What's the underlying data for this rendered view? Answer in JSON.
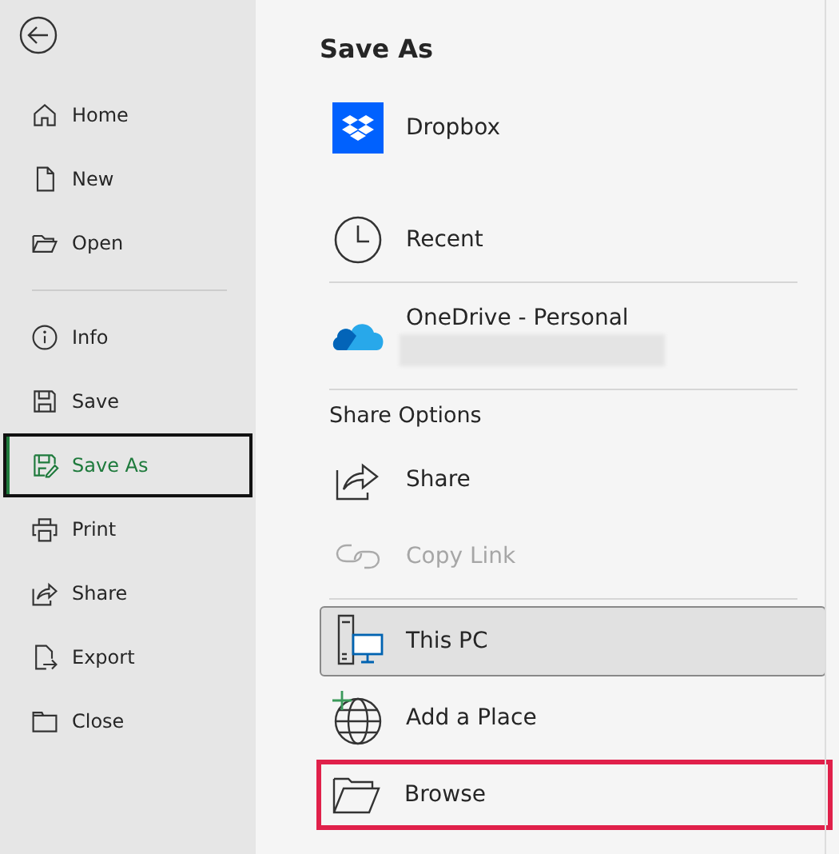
{
  "sidebar": {
    "items": [
      {
        "kind": "item",
        "label": "Home",
        "selected": false
      },
      {
        "kind": "item",
        "label": "New",
        "selected": false
      },
      {
        "kind": "item",
        "label": "Open",
        "selected": false
      },
      {
        "kind": "divider"
      },
      {
        "kind": "item",
        "label": "Info",
        "selected": false
      },
      {
        "kind": "item",
        "label": "Save",
        "selected": false
      },
      {
        "kind": "item",
        "label": "Save As",
        "selected": true
      },
      {
        "kind": "item",
        "label": "Print",
        "selected": false
      },
      {
        "kind": "item",
        "label": "Share",
        "selected": false
      },
      {
        "kind": "item",
        "label": "Export",
        "selected": false
      },
      {
        "kind": "item",
        "label": "Close",
        "selected": false
      }
    ]
  },
  "main": {
    "title": "Save As",
    "locations": [
      {
        "kind": "location",
        "label": "Dropbox",
        "selected": false,
        "disabled": false,
        "highlighted": false
      },
      {
        "kind": "location",
        "label": "Recent",
        "selected": false,
        "disabled": false,
        "highlighted": false
      },
      {
        "kind": "divider"
      },
      {
        "kind": "location",
        "label": "OneDrive - Personal",
        "account_redacted": true,
        "selected": false,
        "disabled": false,
        "highlighted": false
      },
      {
        "kind": "divider"
      },
      {
        "kind": "header",
        "label": "Share Options"
      },
      {
        "kind": "location",
        "label": "Share",
        "selected": false,
        "disabled": false,
        "highlighted": false
      },
      {
        "kind": "location",
        "label": "Copy Link",
        "selected": false,
        "disabled": true,
        "highlighted": false
      },
      {
        "kind": "divider"
      },
      {
        "kind": "location",
        "label": "This PC",
        "selected": true,
        "disabled": false,
        "highlighted": false
      },
      {
        "kind": "location",
        "label": "Add a Place",
        "selected": false,
        "disabled": false,
        "highlighted": false
      },
      {
        "kind": "location",
        "label": "Browse",
        "selected": false,
        "disabled": false,
        "highlighted": true
      }
    ]
  }
}
